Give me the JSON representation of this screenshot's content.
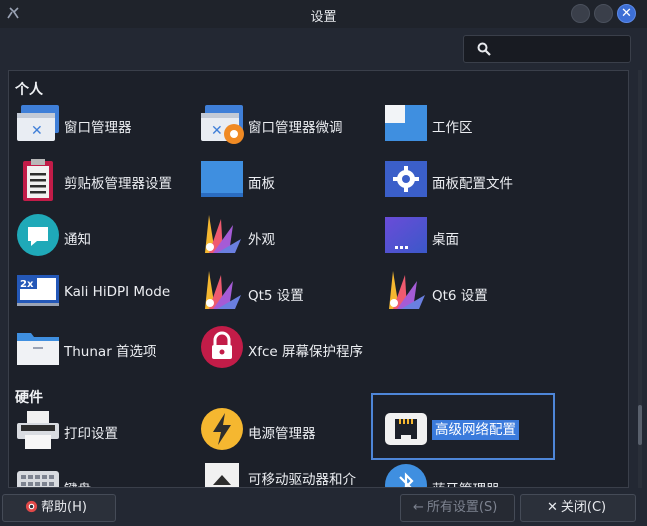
{
  "window": {
    "title": "设置"
  },
  "search": {
    "placeholder": ""
  },
  "sections": {
    "personal": "个人",
    "hardware": "硬件"
  },
  "items": {
    "window_manager": "窗口管理器",
    "window_manager_tweaks": "窗口管理器微调",
    "workspaces": "工作区",
    "clipboard_manager": "剪贴板管理器设置",
    "panel": "面板",
    "panel_profiles": "面板配置文件",
    "notifications": "通知",
    "appearance": "外观",
    "desktop": "桌面",
    "kali_hidpi": "Kali HiDPI Mode",
    "qt5_settings": "Qt5 设置",
    "qt6_settings": "Qt6 设置",
    "thunar_prefs": "Thunar 首选项",
    "screensaver": "Xfce 屏幕保护程序",
    "printing": "打印设置",
    "power_manager": "电源管理器",
    "advanced_network": "高级网络配置",
    "keyboard": "键盘",
    "removable_drives": "可移动驱动器和介",
    "bluetooth": "蓝牙管理器"
  },
  "buttons": {
    "help": "帮助(H)",
    "all_settings": "所有设置(S)",
    "close": "关闭(C)"
  },
  "colors": {
    "accent": "#3b7bdc",
    "selection_border": "#4e86d8"
  }
}
